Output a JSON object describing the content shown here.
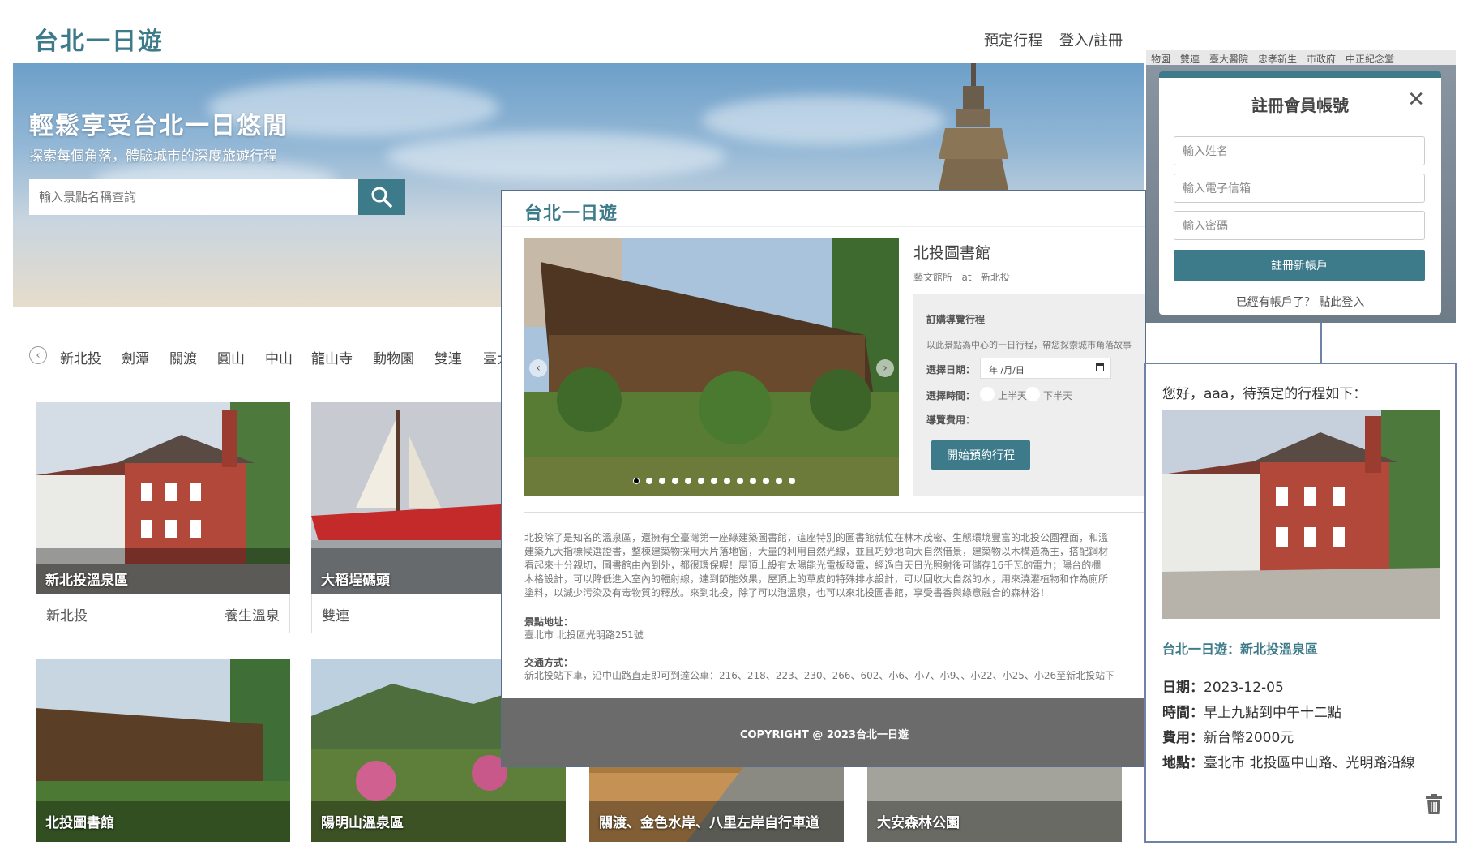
{
  "main": {
    "brand": "台北一日遊",
    "nav": [
      "預定行程",
      "登入/註冊"
    ],
    "hero": {
      "title": "輕鬆享受台北一日悠閒",
      "subtitle": "探索每個角落，體驗城市的深度旅遊行程",
      "search_placeholder": "輸入景點名稱查詢"
    },
    "categories": [
      "新北投",
      "劍潭",
      "關渡",
      "圓山",
      "中山",
      "龍山寺",
      "動物園",
      "雙連",
      "臺大"
    ],
    "cards_row1": [
      {
        "title": "新北投溫泉區",
        "district": "新北投",
        "tag": "養生溫泉"
      },
      {
        "title": "大稻埕碼頭",
        "district": "雙連",
        "tag": ""
      }
    ],
    "cards_row2": [
      {
        "title": "北投圖書館"
      },
      {
        "title": "陽明山溫泉區"
      },
      {
        "title": "關渡、金色水岸、八里左岸自行車道"
      },
      {
        "title": "大安森林公園"
      }
    ]
  },
  "detail": {
    "brand": "台北一日遊",
    "title": "北投圖書館",
    "category": "藝文館所",
    "at": "at",
    "district": "新北投",
    "booking": {
      "heading": "訂購導覽行程",
      "desc": "以此景點為中心的一日行程，帶您探索城市角落故事",
      "date_label": "選擇日期：",
      "date_placeholder": "年 /月/日",
      "time_label": "選擇時間：",
      "time_opt1": "上半天",
      "time_opt2": "下半天",
      "fee_label": "導覽費用：",
      "button": "開始預約行程"
    },
    "description_lines": [
      "北投除了是知名的溫泉區，還擁有全臺灣第一座綠建築圖書館，這座特別的圖書館就位在林木茂密、生態環境豐富的北投公園裡面，和溫",
      "建築九大指標候選證書，整棟建築物採用大片落地窗，大量的利用自然光線，並且巧妙地向大自然借景，建築物以木構造為主，搭配鋼材",
      "看起來十分親切，圖書館由內到外，都很環保喔！屋頂上設有太陽能光電板發電，經過白天日光照射後可儲存16千瓦的電力；陽台的欄",
      "木格設計，可以降低進入室內的輻射線，達到節能效果，屋頂上的草皮的特殊排水設計，可以回收大自然的水，用來澆灌植物和作為廁所",
      "塗料，以減少污染及有毒物質的釋放。來到北投，除了可以泡溫泉，也可以來北投圖書館，享受書香與綠意融合的森林浴！"
    ],
    "address_label": "景點地址：",
    "address": "臺北市 北投區光明路251號",
    "transport_label": "交通方式：",
    "transport": "新北投站下車，沿中山路直走即可到達公車：216、218、223、230、266、602、小6、小7、小9、、小22、小25、小26至新北投站下",
    "footer": "COPYRIGHT @ 2023台北一日遊"
  },
  "register": {
    "bg_tabs": "物園　雙連　臺大醫院　忠孝新生　市政府　中正紀念堂",
    "title": "註冊會員帳號",
    "name_placeholder": "輸入姓名",
    "email_placeholder": "輸入電子信箱",
    "password_placeholder": "輸入密碼",
    "submit": "註冊新帳戶",
    "login_prompt": "已經有帳戶了？ 點此登入"
  },
  "booking": {
    "greeting": "您好，aaa，待預定的行程如下：",
    "trip_name": "台北一日遊：新北投溫泉區",
    "date_label": "日期：",
    "date": "2023-12-05",
    "time_label": "時間：",
    "time": "早上九點到中午十二點",
    "fee_label": "費用：",
    "fee": "新台幣2000元",
    "place_label": "地點：",
    "place": "臺北市 北投區中山路、光明路沿線"
  },
  "colors": {
    "accent": "#3d7b8a",
    "footer": "#6b6b6b",
    "border": "#6f82a8"
  }
}
